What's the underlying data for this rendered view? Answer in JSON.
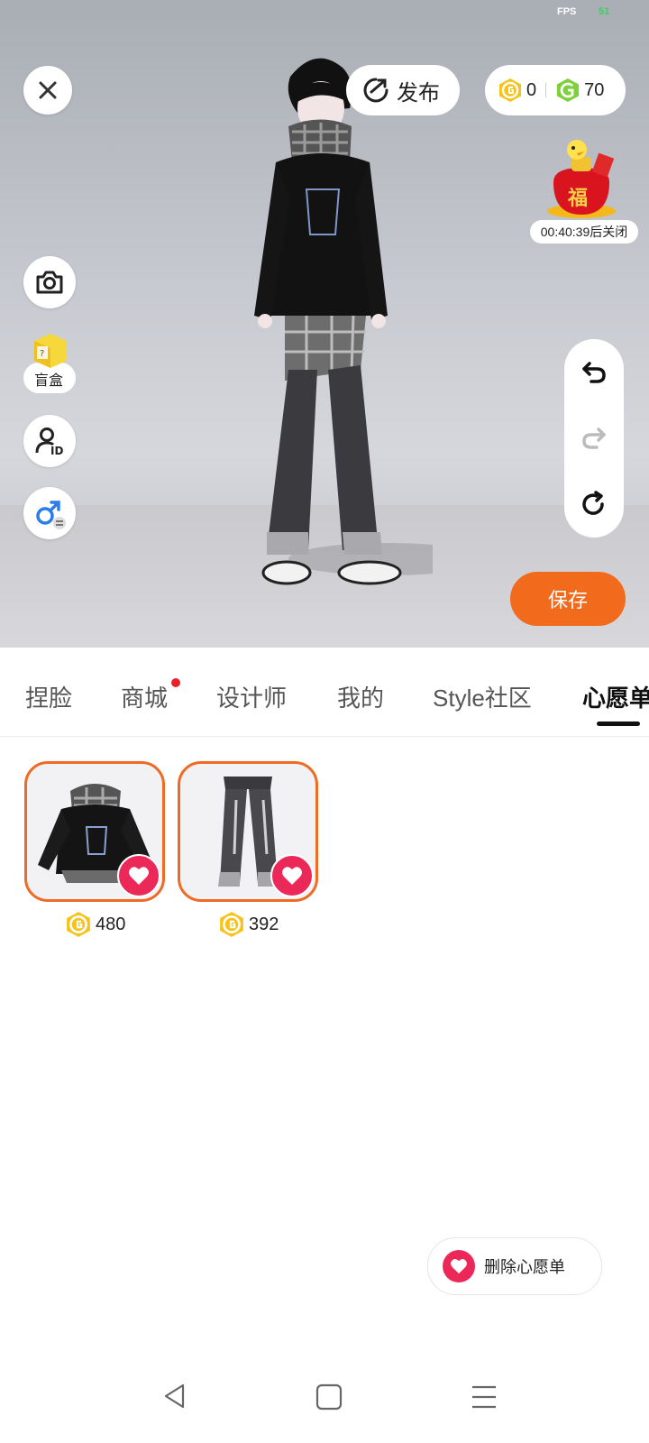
{
  "status": {
    "fps_label": "FPS",
    "fps_value": "51"
  },
  "top_bar": {
    "publish_label": "发布",
    "gold_coins": "0",
    "green_coins": "70"
  },
  "promo": {
    "timer_text": "00:40:39后关闭",
    "badge_char": "福"
  },
  "left_tools": {
    "blind_box_label": "盲盒"
  },
  "save_label": "保存",
  "tabs": [
    {
      "label": "捏脸"
    },
    {
      "label": "商城",
      "has_dot": true
    },
    {
      "label": "设计师"
    },
    {
      "label": "我的"
    },
    {
      "label": "Style社区"
    },
    {
      "label": "心愿单",
      "active": true
    }
  ],
  "wishlist": [
    {
      "name": "hoodie",
      "price": "480"
    },
    {
      "name": "jeans",
      "price": "392"
    }
  ],
  "remove_wishlist_label": "删除心愿单",
  "colors": {
    "accent_orange": "#f26a1b",
    "heart_pink": "#ec2858",
    "coin_gold": "#f7c21a",
    "coin_green": "#7fd13b"
  },
  "icons": {
    "close": "close-icon",
    "camera": "camera-icon",
    "profile": "profile-id-icon",
    "gender": "gender-switch-icon",
    "undo": "undo-icon",
    "redo": "redo-icon",
    "reset": "reset-icon",
    "publish": "publish-icon",
    "heart": "heart-icon"
  }
}
